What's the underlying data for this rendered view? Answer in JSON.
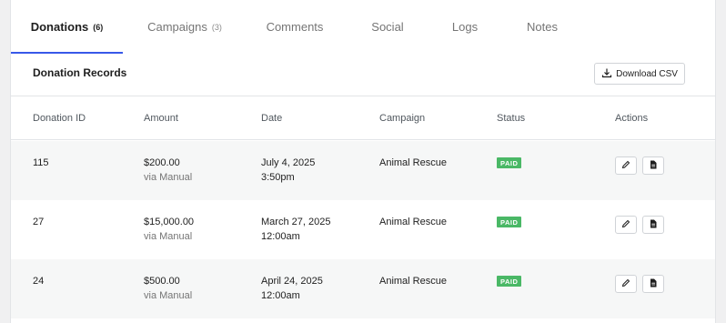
{
  "tabs": [
    {
      "label": "Donations",
      "count": "(6)",
      "active": true
    },
    {
      "label": "Campaigns",
      "count": "(3)",
      "active": false
    },
    {
      "label": "Comments",
      "count": "",
      "active": false
    },
    {
      "label": "Social",
      "count": "",
      "active": false
    },
    {
      "label": "Logs",
      "count": "",
      "active": false
    },
    {
      "label": "Notes",
      "count": "",
      "active": false
    }
  ],
  "section": {
    "title": "Donation Records",
    "download_label": "Download CSV",
    "download_icon": "download-icon"
  },
  "table": {
    "columns": [
      "Donation ID",
      "Amount",
      "Date",
      "Campaign",
      "Status",
      "Actions"
    ],
    "rows": [
      {
        "id": "115",
        "amount": "$200.00",
        "method": "via Manual",
        "date": "July 4, 2025",
        "time": "3:50pm",
        "campaign": "Animal Rescue",
        "status": "PAID"
      },
      {
        "id": "27",
        "amount": "$15,000.00",
        "method": "via Manual",
        "date": "March 27, 2025",
        "time": "12:00am",
        "campaign": "Animal Rescue",
        "status": "PAID"
      },
      {
        "id": "24",
        "amount": "$500.00",
        "method": "via Manual",
        "date": "April 24, 2025",
        "time": "12:00am",
        "campaign": "Animal Rescue",
        "status": "PAID"
      }
    ],
    "action_icons": [
      "pencil-icon",
      "document-icon"
    ]
  },
  "colors": {
    "accent": "#3858e9",
    "paid_badge": "#4ab866",
    "row_shade": "#f6f7f7",
    "page_bg": "#f0f0f1"
  }
}
